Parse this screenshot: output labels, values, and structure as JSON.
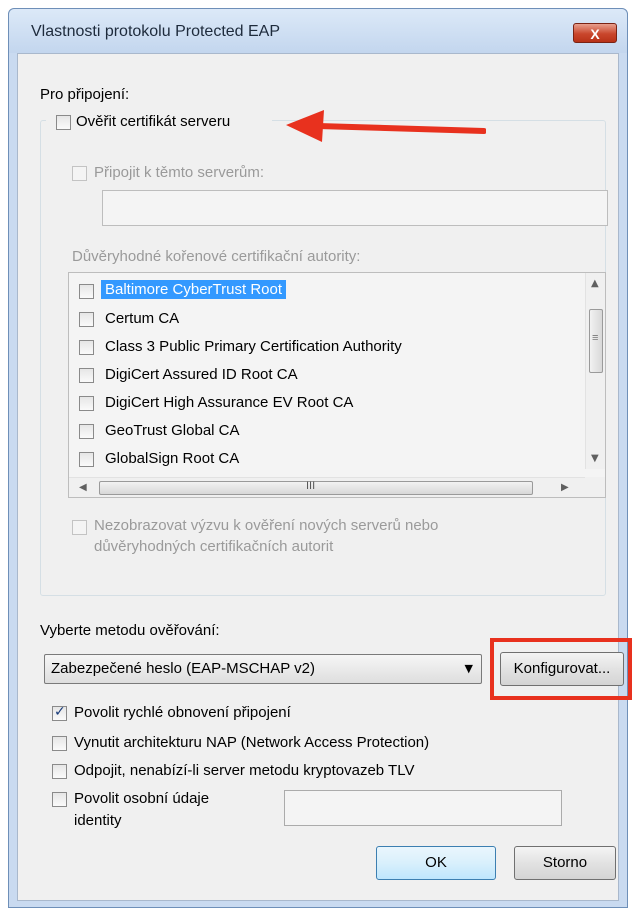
{
  "window": {
    "title": "Vlastnosti protokolu Protected EAP",
    "close_label": "X"
  },
  "connection": {
    "heading": "Pro připojení:",
    "verify_cert_label": "Ověřit certifikát serveru",
    "verify_cert_checked": false,
    "connect_servers_label": "Připojit k těmto serverům:",
    "servers_value": "",
    "trusted_ca_label": "Důvěryhodné kořenové certifikační autority:",
    "ca_list": [
      {
        "label": "Baltimore CyberTrust Root",
        "selected": true
      },
      {
        "label": "Certum CA"
      },
      {
        "label": "Class 3 Public Primary Certification Authority"
      },
      {
        "label": "DigiCert Assured ID Root CA"
      },
      {
        "label": "DigiCert High Assurance EV Root CA"
      },
      {
        "label": "GeoTrust Global CA"
      },
      {
        "label": "GlobalSign Root CA"
      }
    ],
    "scroll_h_thumb_text": "III",
    "scroll_v_thumb_text": "≡",
    "no_prompt_label_line1": "Nezobrazovat výzvu k ověření nových serverů nebo",
    "no_prompt_label_line2": "důvěryhodných certifikačních autorit"
  },
  "auth": {
    "heading": "Vyberte metodu ověřování:",
    "method_value": "Zabezpečené heslo (EAP-MSCHAP v2)",
    "configure_label": "Konfigurovat...",
    "fast_reconnect_label": "Povolit rychlé obnovení připojení",
    "fast_reconnect_checked": true,
    "nap_label": "Vynutit architekturu NAP (Network Access Protection)",
    "disconnect_label": "Odpojit, nenabízí-li server metodu kryptovazeb TLV",
    "privacy_label_line1": "Povolit osobní údaje",
    "privacy_label_line2": "identity",
    "identity_value": ""
  },
  "buttons": {
    "ok_label": "OK",
    "cancel_label": "Storno"
  },
  "annotations": {
    "accent_color": "#e8311e"
  }
}
